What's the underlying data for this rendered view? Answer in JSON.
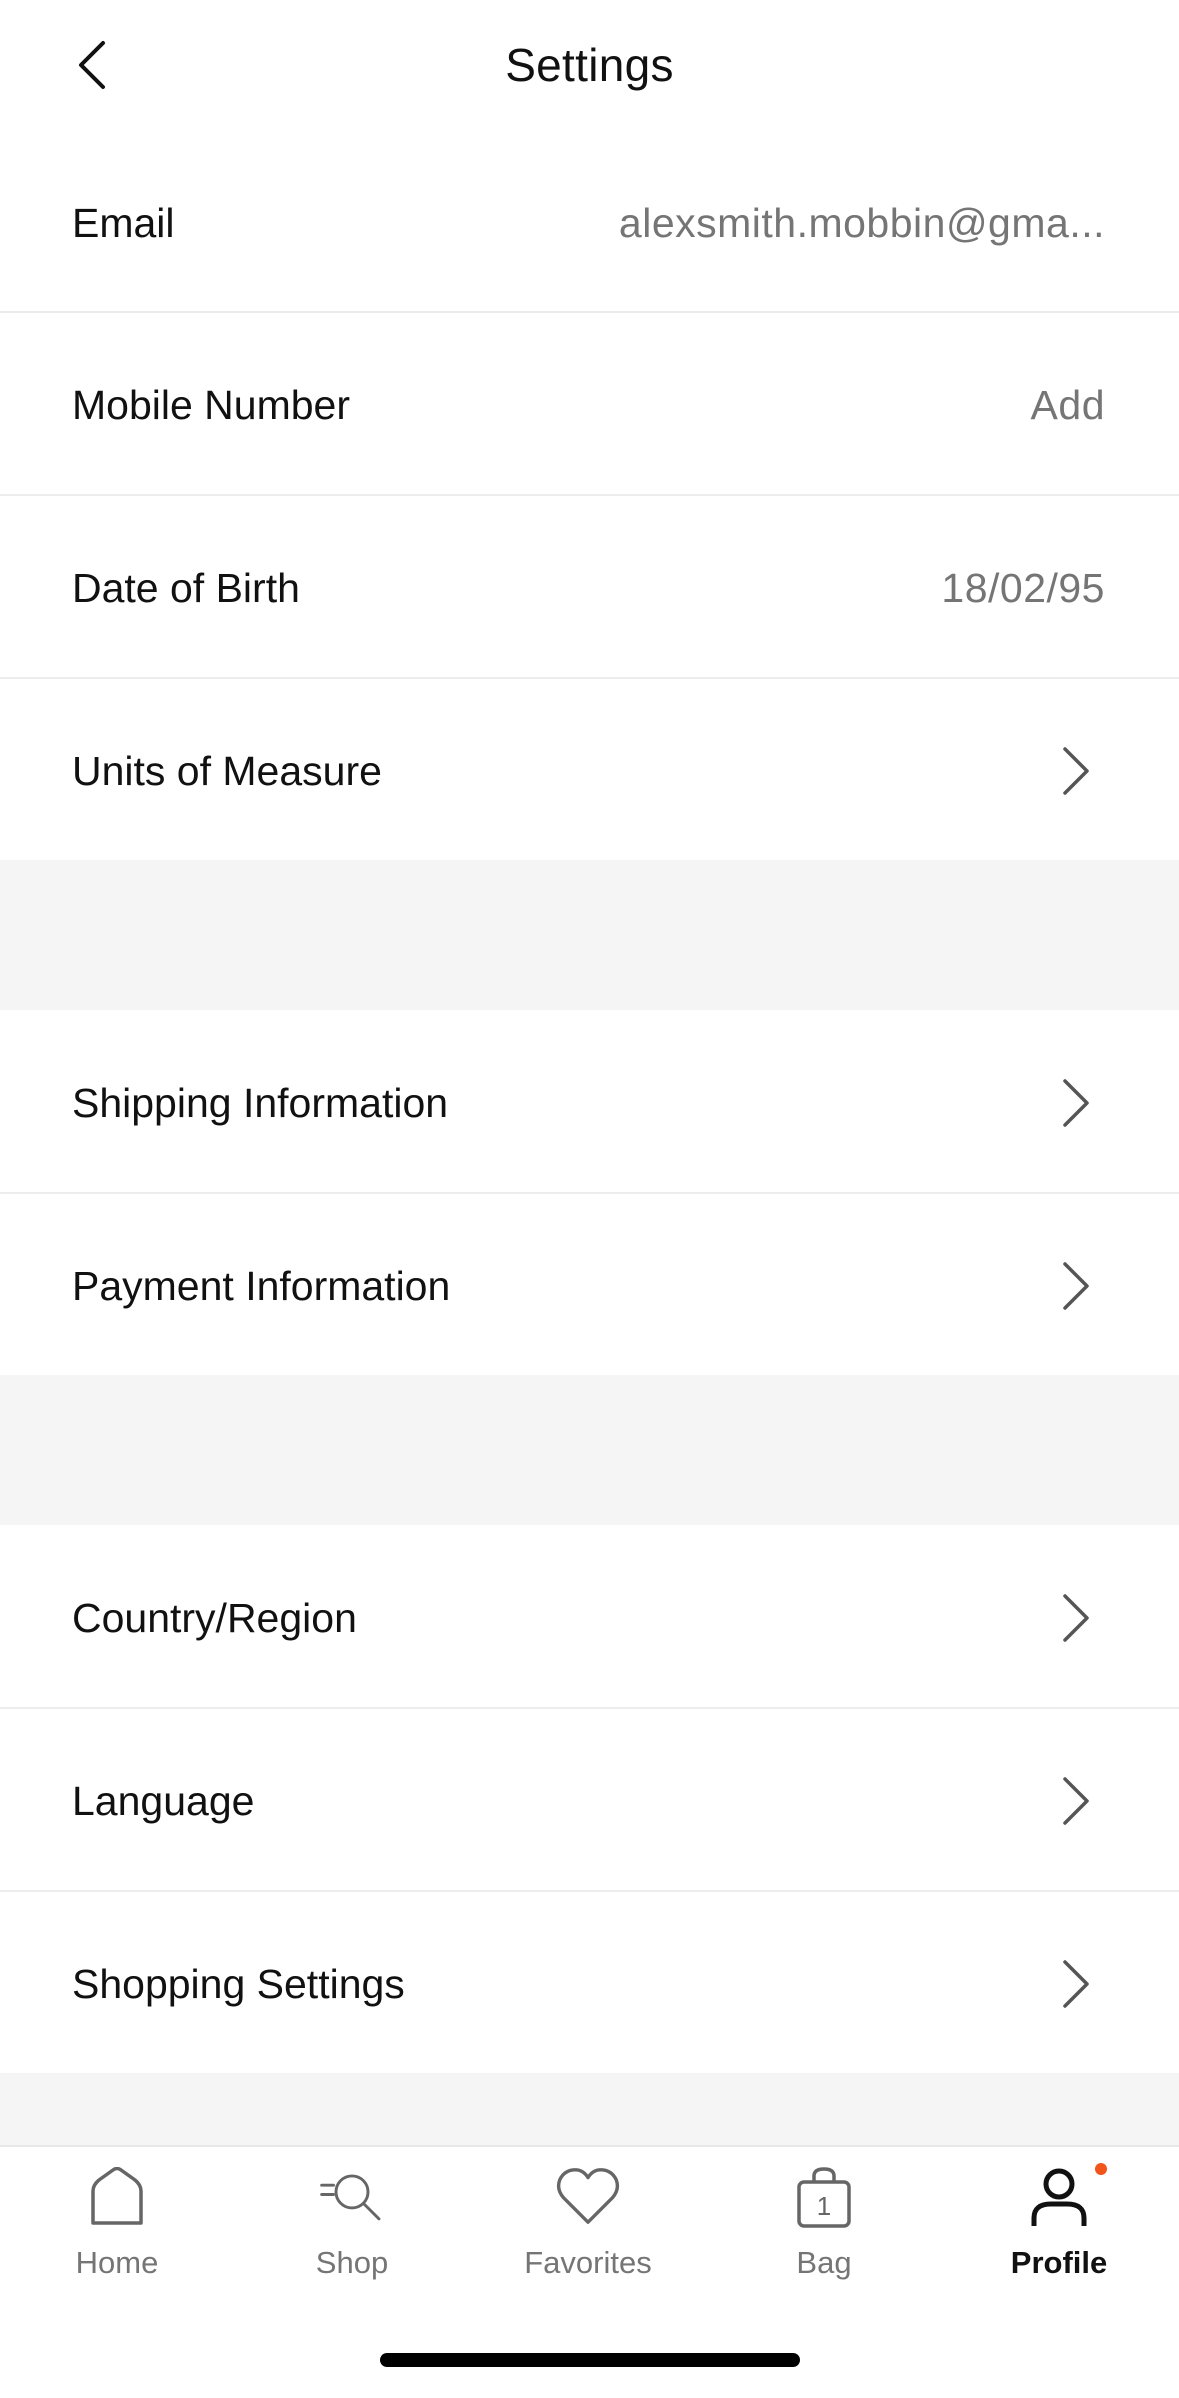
{
  "header": {
    "title": "Settings"
  },
  "account_rows": [
    {
      "label": "Email",
      "value": "alexsmith.mobbin@gma..."
    },
    {
      "label": "Mobile Number",
      "value": "Add"
    },
    {
      "label": "Date of Birth",
      "value": "18/02/95"
    },
    {
      "label": "Units of Measure"
    }
  ],
  "billing_rows": [
    {
      "label": "Shipping Information"
    },
    {
      "label": "Payment Information"
    }
  ],
  "preference_rows": [
    {
      "label": "Country/Region"
    },
    {
      "label": "Language"
    },
    {
      "label": "Shopping Settings"
    }
  ],
  "tabbar": {
    "items": [
      {
        "label": "Home",
        "icon": "home-icon"
      },
      {
        "label": "Shop",
        "icon": "shop-search-icon"
      },
      {
        "label": "Favorites",
        "icon": "heart-icon"
      },
      {
        "label": "Bag",
        "icon": "bag-icon",
        "badge": "1"
      },
      {
        "label": "Profile",
        "icon": "profile-icon",
        "active": true
      }
    ],
    "notification_dot_color": "#f2541b"
  }
}
